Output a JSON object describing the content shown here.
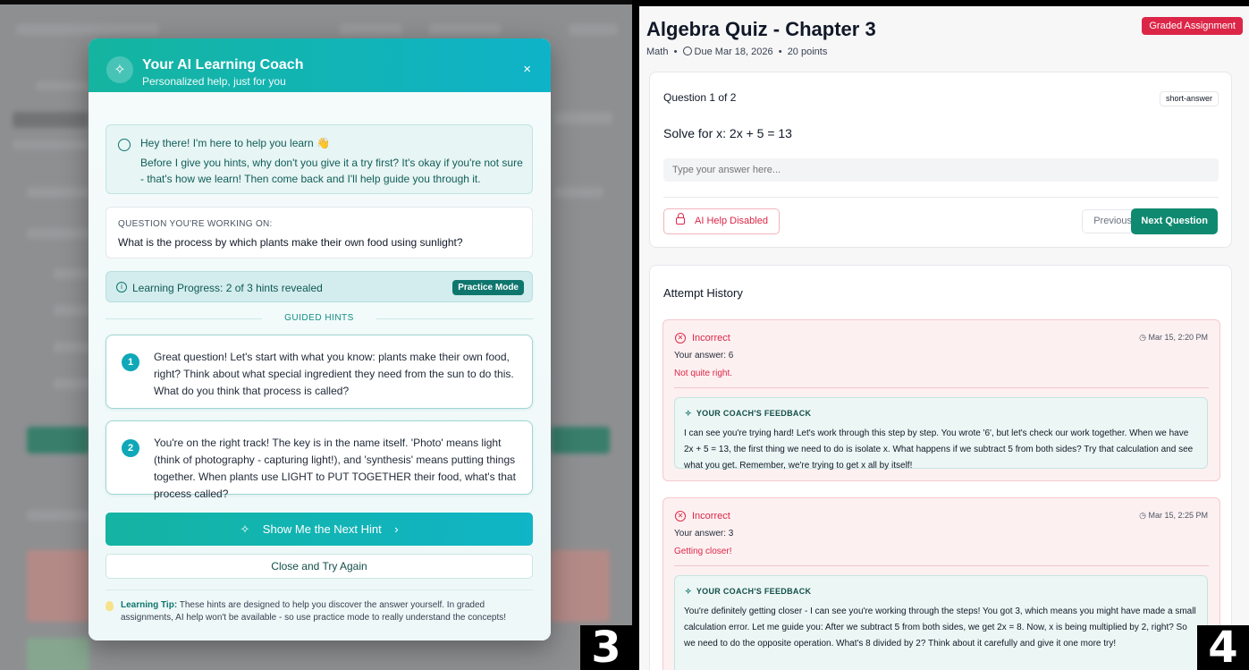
{
  "left_panel": {
    "badge": "3",
    "coach": {
      "title": "Your AI Learning Coach",
      "subtitle": "Personalized help, just for you",
      "close": "×",
      "intro_heading": "Hey there! I'm here to help you learn 👋",
      "intro_body": "Before I give you hints, why don't you give it a try first? It's okay if you're not sure - that's how we learn! Then come back and I'll help guide you through it.",
      "question_label": "QUESTION YOU'RE WORKING ON:",
      "question": "What is the process by which plants make their own food using sunlight?",
      "progress_text": "Learning Progress: 2 of 3 hints revealed",
      "mode_badge": "Practice Mode",
      "hints_heading": "GUIDED HINTS",
      "hints": [
        {
          "number": "1",
          "text": "Great question! Let's start with what you know: plants make their own food, right? Think about what special ingredient they need from the sun to do this. What do you think that process is called?"
        },
        {
          "number": "2",
          "text": "You're on the right track! The key is in the name itself. 'Photo' means light (think of photography - capturing light!), and 'synthesis' means putting things together. When plants use LIGHT to PUT TOGETHER their food, what's that process called?"
        }
      ],
      "next_hint_button": "Show Me the Next Hint",
      "close_button": "Close and Try Again",
      "tip_label": "Learning Tip:",
      "tip_text": " These hints are designed to help you discover the answer yourself. In graded assignments, AI help won't be available - so use practice mode to really understand the concepts!"
    }
  },
  "right_panel": {
    "badge": "4",
    "title": "Algebra Quiz - Chapter 3",
    "subject": "Math",
    "due": "Due Mar 18, 2026",
    "points": "20 points",
    "status_badge": "Graded Assignment",
    "question": {
      "counter": "Question 1 of 2",
      "type": "short-answer",
      "prompt": "Solve for x: 2x + 5 = 13",
      "answer_placeholder": "Type your answer here...",
      "ai_help_label": "AI Help Disabled",
      "previous_label": "Previous",
      "next_label": "Next Question"
    },
    "history": {
      "title": "Attempt History",
      "attempts": [
        {
          "status": "Incorrect",
          "time": "Mar 15, 2:20 PM",
          "answer": "Your answer: 6",
          "message": "Not quite right.",
          "feedback_heading": "YOUR COACH'S FEEDBACK",
          "feedback": "I can see you're trying hard! Let's work through this step by step. You wrote '6', but let's check our work together. When we have 2x + 5 = 13, the first thing we need to do is isolate x. What happens if we subtract 5 from both sides? Try that calculation and see what you get. Remember, we're trying to get x all by itself!"
        },
        {
          "status": "Incorrect",
          "time": "Mar 15, 2:25 PM",
          "answer": "Your answer: 3",
          "message": "Getting closer!",
          "feedback_heading": "YOUR COACH'S FEEDBACK",
          "feedback": "You're definitely getting closer - I can see you're working through the steps! You got 3, which means you might have made a small calculation error. Let me guide you: After we subtract 5 from both sides, we get 2x = 8. Now, x is being multiplied by 2, right? So we need to do the opposite operation. What's 8 divided by 2? Think about it carefully and give it one more try!"
        }
      ]
    }
  }
}
